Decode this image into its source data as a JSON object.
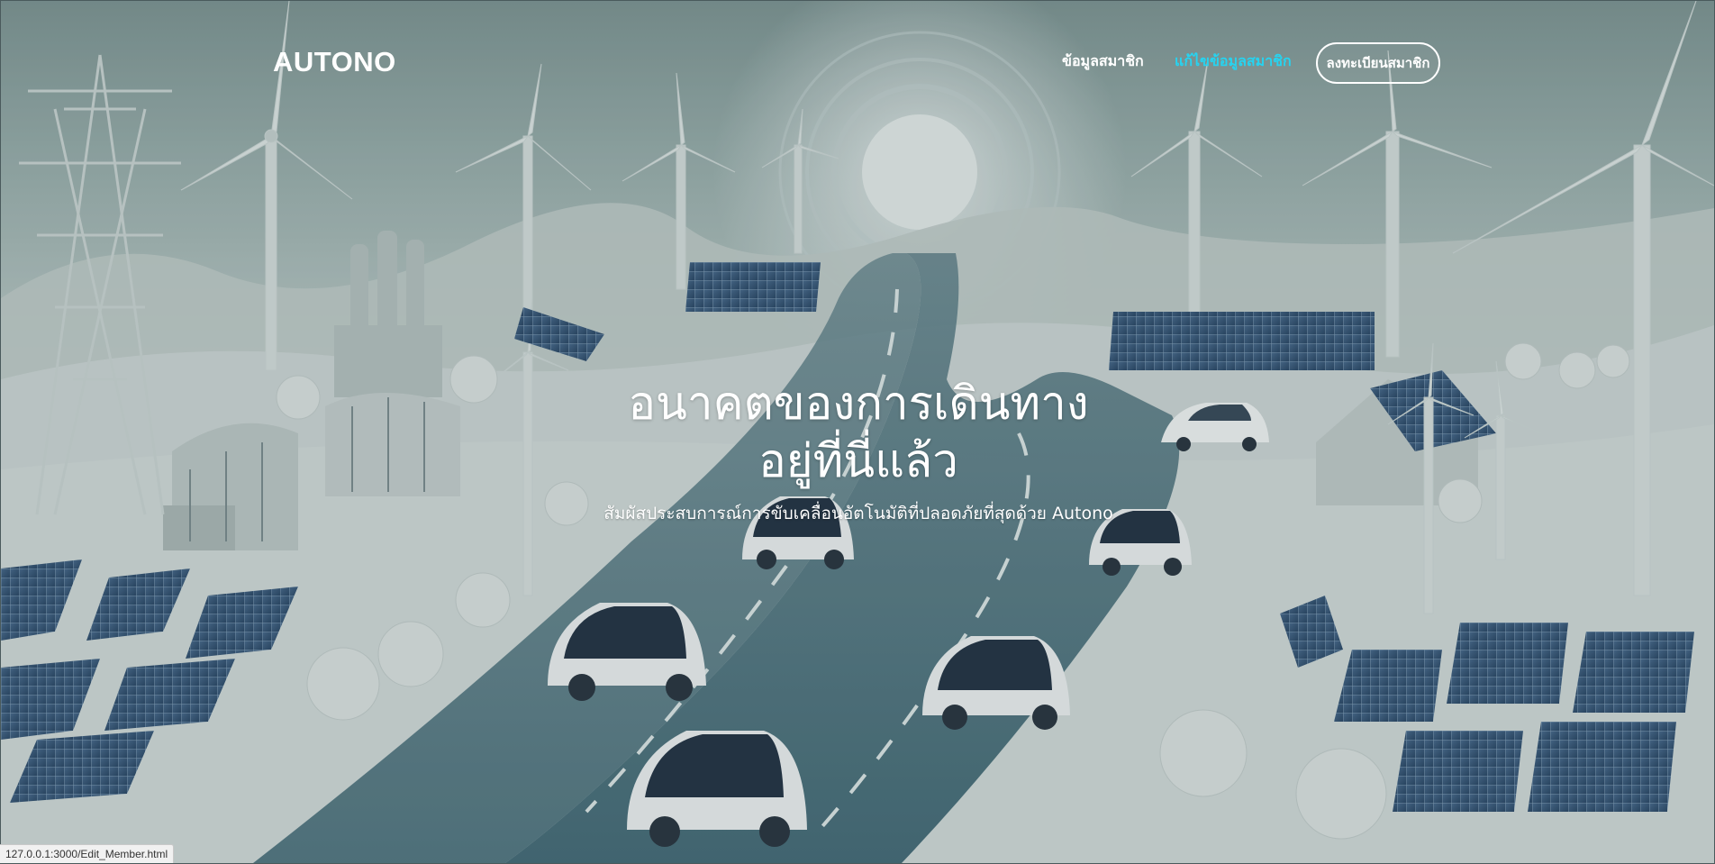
{
  "header": {
    "brand": "AUTONO",
    "nav": {
      "member_info": "ข้อมูลสมาชิก",
      "edit_member_info": "แก้ไขข้อมูลสมาชิก",
      "register": "ลงทะเบียนสมาชิก"
    }
  },
  "hero": {
    "title_line1": "อนาคตของการเดินทาง",
    "title_line2": "อยู่ที่นี่แล้ว",
    "subtitle": "สัมผัสประสบการณ์การขับเคลื่อนอัตโนมัติที่ปลอดภัยที่สุดด้วย Autono"
  },
  "status_bar": {
    "url": "127.0.0.1:3000/Edit_Member.html"
  },
  "colors": {
    "accent_link": "#26d3f0",
    "text": "#ffffff"
  }
}
